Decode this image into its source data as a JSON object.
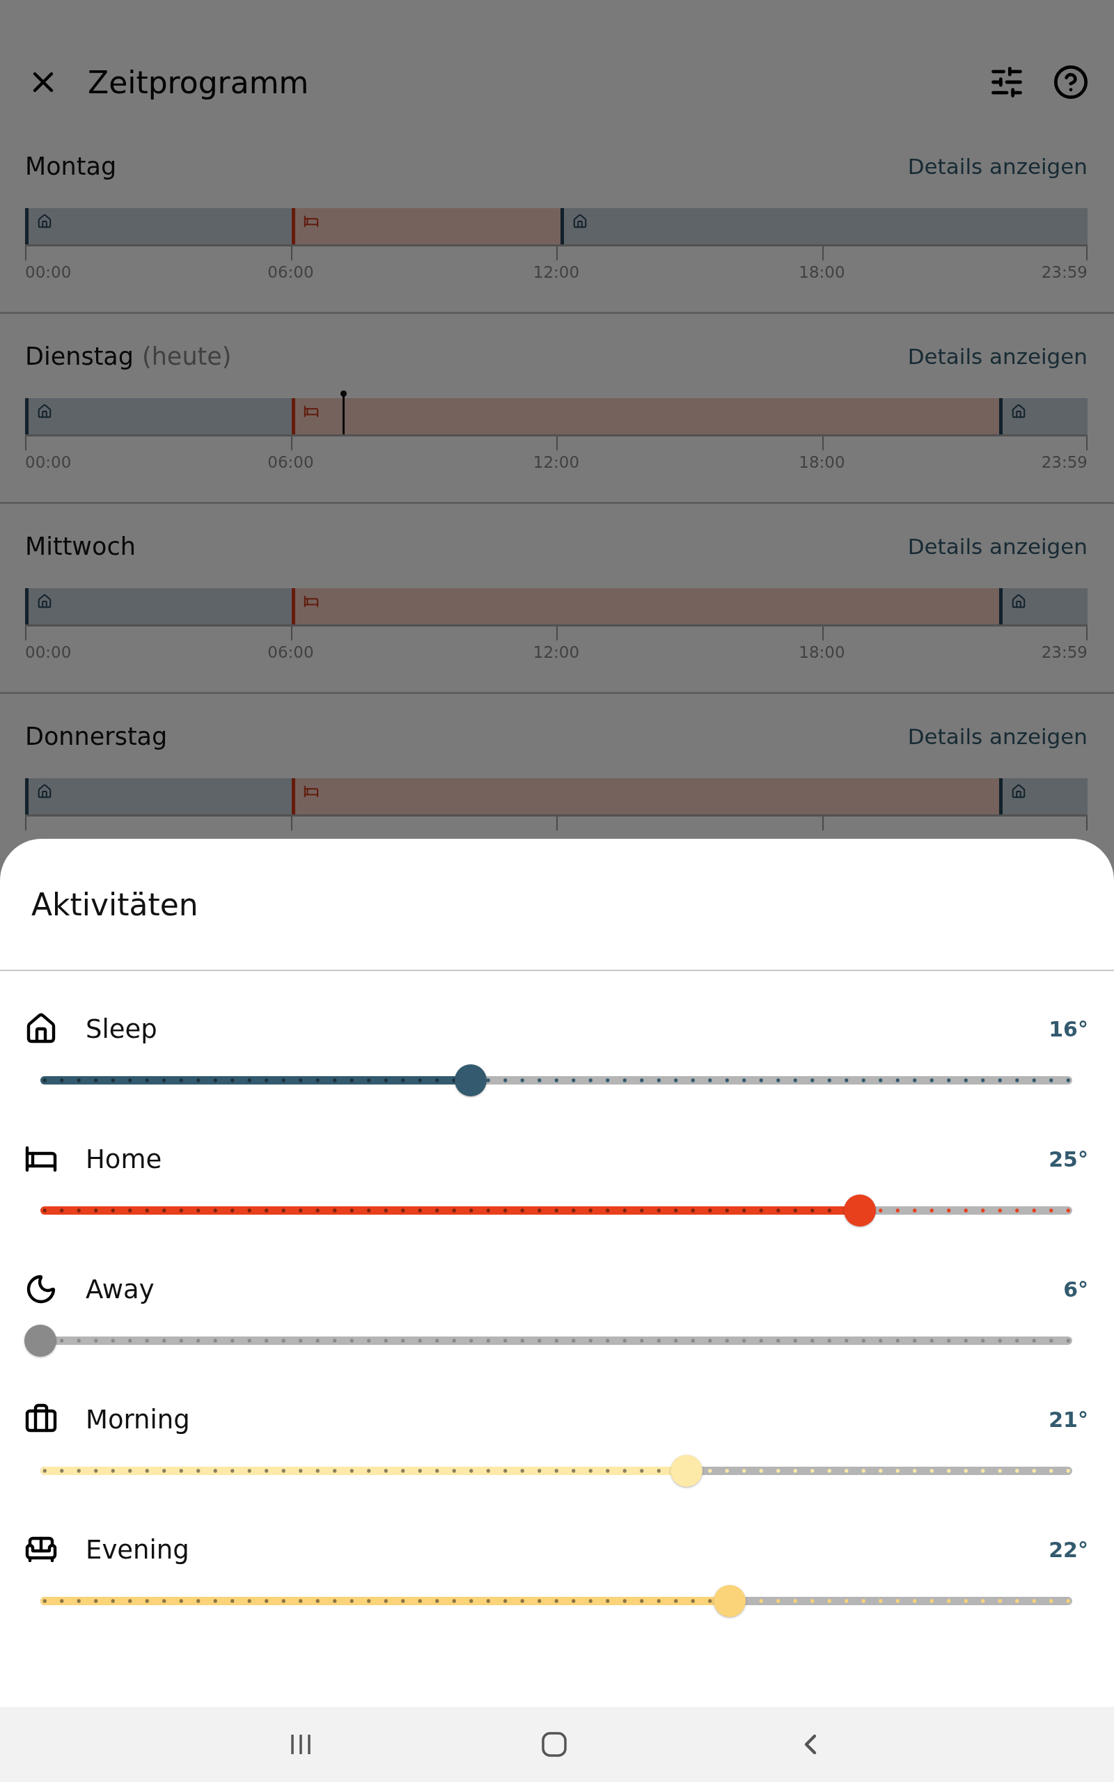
{
  "header": {
    "title": "Zeitprogramm"
  },
  "days": [
    {
      "name": "Montag",
      "link": "Details anzeigen",
      "segments": [
        {
          "kind": "home",
          "level": 0
        },
        {
          "kind": "bed",
          "level": 0.251
        },
        {
          "kind": "home",
          "level": 0.504
        }
      ],
      "ticks": [
        "00:00",
        "06:00",
        "12:00",
        "18:00",
        "23:59"
      ]
    },
    {
      "name": "Dienstag",
      "note": "(heute)",
      "link": "Details anzeigen",
      "now_marker": {
        "level": 0.299
      },
      "segments": [
        {
          "kind": "home",
          "level": 0
        },
        {
          "kind": "bed",
          "level": 0.251
        },
        {
          "kind": "home",
          "level": 0.917
        }
      ],
      "ticks": [
        "00:00",
        "06:00",
        "12:00",
        "18:00",
        "23:59"
      ]
    },
    {
      "name": "Mittwoch",
      "link": "Details anzeigen",
      "segments": [
        {
          "kind": "home",
          "level": 0
        },
        {
          "kind": "bed",
          "level": 0.251
        },
        {
          "kind": "home",
          "level": 0.917
        }
      ],
      "ticks": [
        "00:00",
        "06:00",
        "12:00",
        "18:00",
        "23:59"
      ]
    },
    {
      "name": "Donnerstag",
      "link": "Details anzeigen",
      "segments": [
        {
          "kind": "home",
          "level": 0
        },
        {
          "kind": "bed",
          "level": 0.251
        },
        {
          "kind": "home",
          "level": 0.917
        }
      ]
    }
  ],
  "sheet": {
    "title": "Aktivitäten",
    "activities": [
      {
        "kind": "home",
        "name": "Sleep",
        "value": "16°",
        "level": 0.417,
        "color": "#335a6e"
      },
      {
        "kind": "bed",
        "name": "Home",
        "value": "25°",
        "level": 0.794,
        "color": "#e8401c"
      },
      {
        "kind": "moon",
        "name": "Away",
        "value": "6°",
        "level": 0,
        "color": "#8a8a8a"
      },
      {
        "kind": "briefcase",
        "name": "Morning",
        "value": "21°",
        "level": 0.626,
        "color": "#fde9a8"
      },
      {
        "kind": "sofa",
        "name": "Evening",
        "value": "22°",
        "level": 0.668,
        "color": "#fbd47a"
      }
    ]
  }
}
